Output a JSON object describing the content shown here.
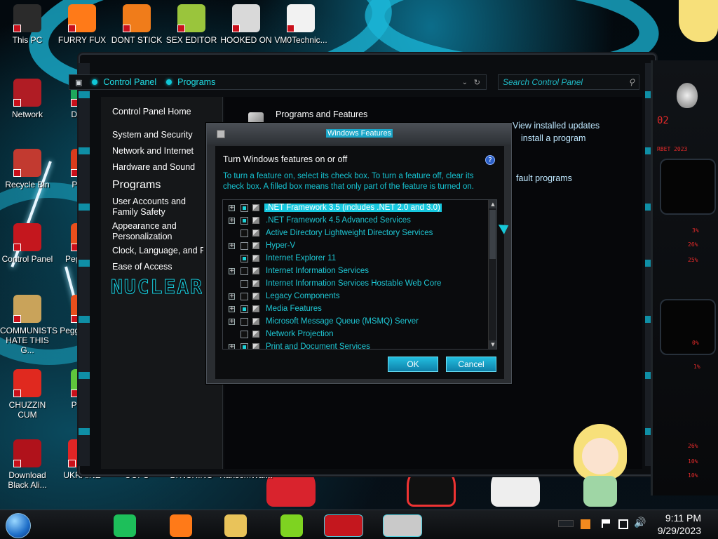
{
  "desktop_icons": [
    {
      "label": "This PC",
      "color": "#2b2b2b"
    },
    {
      "label": "FURRY FUX",
      "color": "#ff7a18"
    },
    {
      "label": "DONT STICK",
      "color": "#f07c1a"
    },
    {
      "label": "SEX EDITOR",
      "color": "#9ac53c"
    },
    {
      "label": "HOOKED ON",
      "color": "#d9d9d9"
    },
    {
      "label": "VM0Technic...",
      "color": "#f2f2f2"
    },
    {
      "label": "Network",
      "color": "#b01c24"
    },
    {
      "label": "Recycle Bin",
      "color": "#c23a30"
    },
    {
      "label": "Control Panel",
      "color": "#c4171e"
    },
    {
      "label": "COMMUNISTS HATE THIS G...",
      "color": "#c9a35a"
    },
    {
      "label": "CHUZZIN CUM",
      "color": "#e0291f"
    },
    {
      "label": "Download Black Ali...",
      "color": "#b0121b"
    },
    {
      "label": "UKRAINE",
      "color": "#e02525"
    },
    {
      "label": "OOPS",
      "color": "#0d0d0d"
    },
    {
      "label": "LYNCHING",
      "color": "#0d0d0d"
    },
    {
      "label": "RansomWar...",
      "color": "#0d0d0d"
    },
    {
      "label": "D DUM",
      "color": "#1ea85c"
    },
    {
      "label": "Peggle",
      "color": "#d93b1c"
    },
    {
      "label": "Peggle De",
      "color": "#e84f1c"
    },
    {
      "label": "Peggle of Wa",
      "color": "#e84f1c"
    },
    {
      "label": "Plar Zo",
      "color": "#5fc53c"
    }
  ],
  "explorer": {
    "breadcrumb": [
      "Control Panel",
      "Programs"
    ],
    "search_placeholder": "Search Control Panel",
    "nav_items": [
      "Control Panel Home",
      "System and Security",
      "Network and Internet",
      "Hardware and Sound",
      "Programs",
      "User Accounts and Family Safety",
      "Appearance and Personalization",
      "Clock, Language, and Region",
      "Ease of Access"
    ],
    "nav_wordmark": "NUCLEAR",
    "main_heading": "Programs and Features",
    "main_links": [
      "View installed updates",
      "install a program",
      "fault programs"
    ]
  },
  "dialog": {
    "title": "Windows Features",
    "heading": "Turn Windows features on or off",
    "description": "To turn a feature on, select its check box. To turn a feature off, clear its check box. A filled box means that only part of the feature is turned on.",
    "help_glyph": "?",
    "features": [
      {
        "label": ".NET Framework 3.5 (includes .NET 2.0 and 3.0)",
        "expandable": true,
        "state": "partial",
        "selected": true
      },
      {
        "label": ".NET Framework 4.5 Advanced Services",
        "expandable": true,
        "state": "partial",
        "selected": false
      },
      {
        "label": "Active Directory Lightweight Directory Services",
        "expandable": false,
        "state": "off",
        "selected": false
      },
      {
        "label": "Hyper-V",
        "expandable": true,
        "state": "off",
        "selected": false
      },
      {
        "label": "Internet Explorer 11",
        "expandable": false,
        "state": "partial",
        "selected": false
      },
      {
        "label": "Internet Information Services",
        "expandable": true,
        "state": "off",
        "selected": false
      },
      {
        "label": "Internet Information Services Hostable Web Core",
        "expandable": false,
        "state": "off",
        "selected": false
      },
      {
        "label": "Legacy Components",
        "expandable": true,
        "state": "off",
        "selected": false
      },
      {
        "label": "Media Features",
        "expandable": true,
        "state": "partial",
        "selected": false
      },
      {
        "label": "Microsoft Message Queue (MSMQ) Server",
        "expandable": true,
        "state": "off",
        "selected": false
      },
      {
        "label": "Network Projection",
        "expandable": false,
        "state": "off",
        "selected": false
      },
      {
        "label": "Print and Document Services",
        "expandable": true,
        "state": "partial",
        "selected": false
      }
    ],
    "ok_label": "OK",
    "cancel_label": "Cancel"
  },
  "gadget": {
    "header": "02",
    "lines": [
      "RBET 2023",
      "3%",
      "26%",
      "25%",
      "0%",
      "1%",
      "26%",
      "10%",
      "10%"
    ],
    "accent": "#e42a2a"
  },
  "taskbar": {
    "apps": [
      {
        "name": "notes-app-icon",
        "color": "#1dbf5a"
      },
      {
        "name": "firefox-icon",
        "color": "#ff7a18"
      },
      {
        "name": "file-explorer-icon",
        "color": "#e9c35a"
      },
      {
        "name": "lime-app-icon",
        "color": "#7ed321"
      },
      {
        "name": "control-panel-task-icon",
        "color": "#c4171e"
      },
      {
        "name": "windows-features-task-icon",
        "color": "#c9c9c9"
      }
    ],
    "time": "9:11 PM",
    "date": "9/29/2023"
  }
}
